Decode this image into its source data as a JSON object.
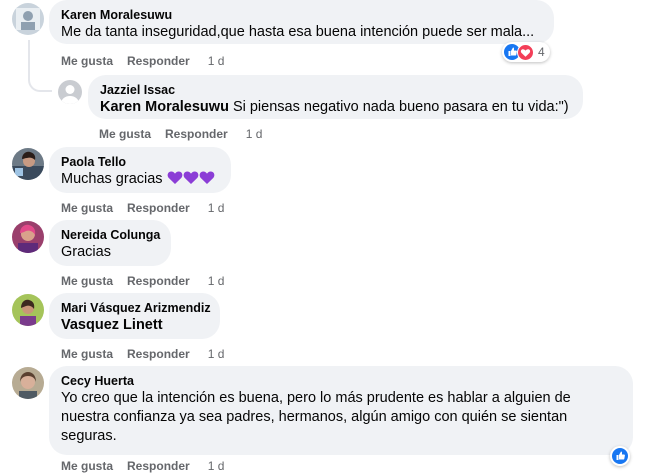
{
  "comments": [
    {
      "author": "Karen Moralesuwu",
      "text": "Me da tanta inseguridad,que hasta esa buena intención puede ser mala...",
      "like_label": "Me gusta",
      "reply_label": "Responder",
      "time": "1 d",
      "reaction_count": "4"
    },
    {
      "author": "Jazziel Issac",
      "mention": "Karen Moralesuwu",
      "text": " Si piensas negativo nada bueno pasara en tu vida:\")",
      "like_label": "Me gusta",
      "reply_label": "Responder",
      "time": "1 d"
    },
    {
      "author": "Paola Tello",
      "text": "Muchas gracias ",
      "like_label": "Me gusta",
      "reply_label": "Responder",
      "time": "1 d"
    },
    {
      "author": "Nereida Colunga",
      "text": "Gracias",
      "like_label": "Me gusta",
      "reply_label": "Responder",
      "time": "1 d"
    },
    {
      "author": "Mari Vásquez Arizmendiz",
      "mention": "Vasquez Linett",
      "like_label": "Me gusta",
      "reply_label": "Responder",
      "time": "1 d"
    },
    {
      "author": "Cecy Huerta",
      "text": "Yo creo que la intención es buena, pero lo más prudente es hablar a alguien de nuestra confianza ya sea padres, hermanos, algún amigo con quién se sientan seguras.",
      "like_label": "Me gusta",
      "reply_label": "Responder",
      "time": "1 d"
    }
  ],
  "colors": {
    "bubble": "#f0f2f5",
    "meta": "#65676b",
    "like_blue": "#1877f2",
    "love_red": "#f33e58",
    "heart_purple": "#8b3dd6"
  },
  "icons": [
    "like-reaction-icon",
    "love-reaction-icon",
    "purple-heart-emoji-icon",
    "default-avatar-icon"
  ]
}
